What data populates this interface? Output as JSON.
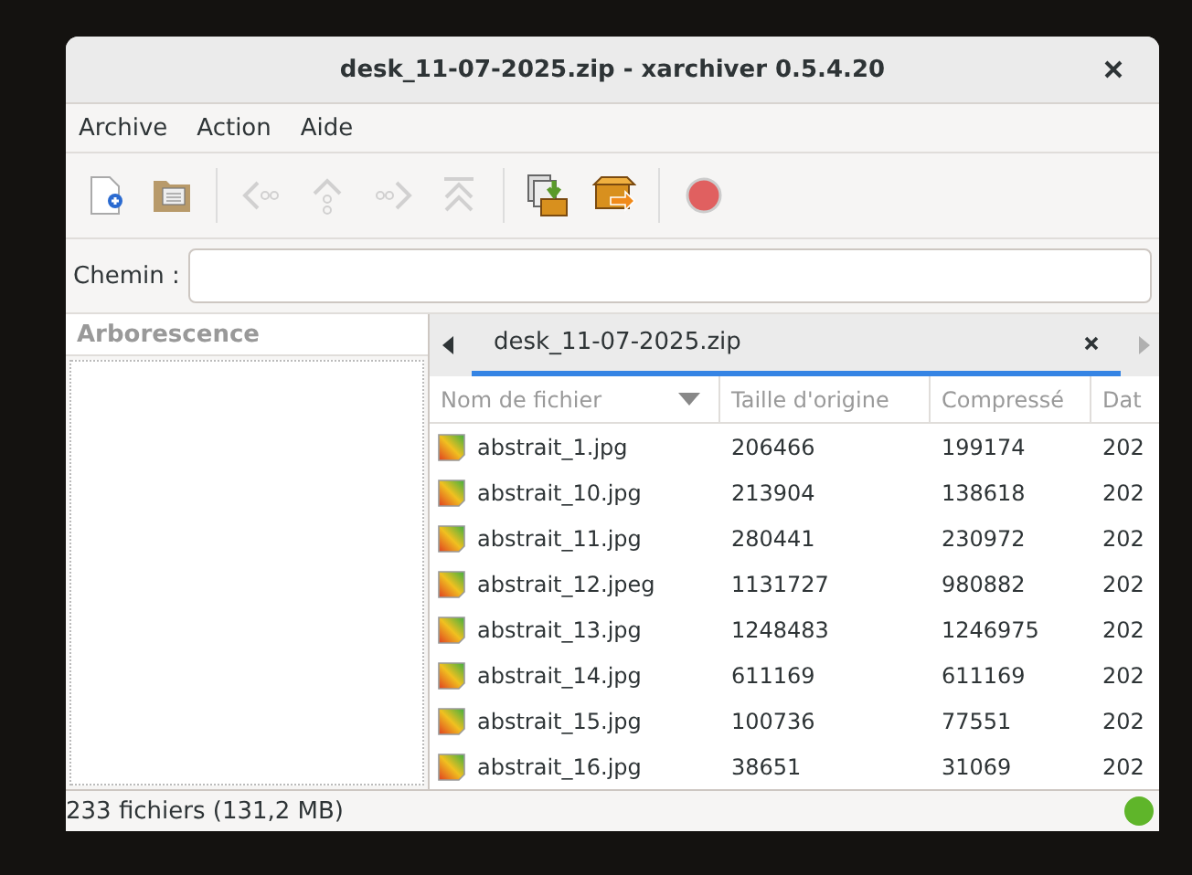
{
  "window": {
    "title": "desk_11-07-2025.zip - xarchiver 0.5.4.20"
  },
  "menu": [
    "Archive",
    "Action",
    "Aide"
  ],
  "toolbar": [
    {
      "kind": "new",
      "disabled": false
    },
    {
      "kind": "open",
      "disabled": false
    },
    {
      "kind": "separator"
    },
    {
      "kind": "back",
      "disabled": true
    },
    {
      "kind": "up",
      "disabled": true
    },
    {
      "kind": "forward",
      "disabled": true
    },
    {
      "kind": "top",
      "disabled": true
    },
    {
      "kind": "separator"
    },
    {
      "kind": "extract",
      "disabled": false
    },
    {
      "kind": "add",
      "disabled": false
    },
    {
      "kind": "separator"
    },
    {
      "kind": "stop",
      "disabled": false
    }
  ],
  "path": {
    "label": "Chemin :"
  },
  "sidebar": {
    "title": "Arborescence"
  },
  "tabs": [
    {
      "label": "desk_11-07-2025.zip",
      "selected": true
    }
  ],
  "table": {
    "columns": [
      {
        "label": "Nom de fichier",
        "sorted": true
      },
      {
        "label": "Taille d'origine",
        "sorted": false
      },
      {
        "label": "Compressé",
        "sorted": false
      },
      {
        "label": "Dat",
        "sorted": false
      }
    ],
    "rows": [
      [
        "abstrait_1.jpg",
        "206466",
        "199174",
        "202"
      ],
      [
        "abstrait_10.jpg",
        "213904",
        "138618",
        "202"
      ],
      [
        "abstrait_11.jpg",
        "280441",
        "230972",
        "202"
      ],
      [
        "abstrait_12.jpeg",
        "1131727",
        "980882",
        "202"
      ],
      [
        "abstrait_13.jpg",
        "1248483",
        "1246975",
        "202"
      ],
      [
        "abstrait_14.jpg",
        "611169",
        "611169",
        "202"
      ],
      [
        "abstrait_15.jpg",
        "100736",
        "77551",
        "202"
      ],
      [
        "abstrait_16.jpg",
        "38651",
        "31069",
        "202"
      ]
    ]
  },
  "status_bar": {
    "text": "233 fichiers  (131,2 MB)",
    "ready": true
  }
}
